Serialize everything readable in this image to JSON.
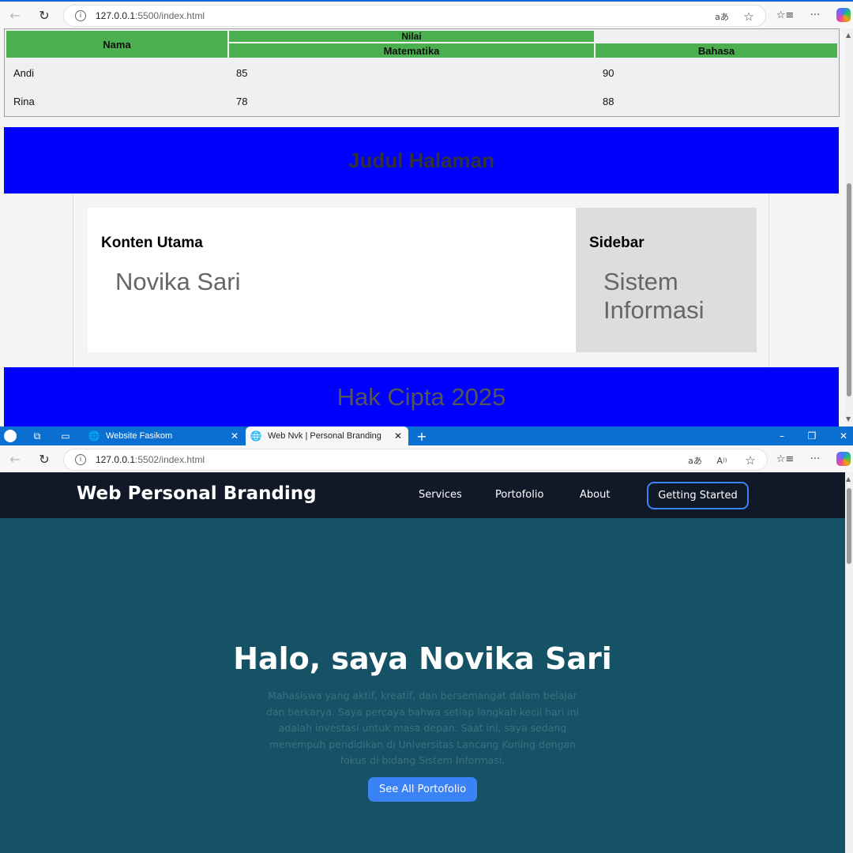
{
  "window_top": {
    "address_bar": {
      "host": "127.0.0.1",
      "path": ":5500/index.html"
    },
    "table": {
      "headers": {
        "nama": "Nama",
        "nilai": "Nilai",
        "matematika": "Matematika",
        "bahasa": "Bahasa"
      },
      "rows": [
        {
          "nama": "Andi",
          "matematika": "85",
          "bahasa": "90"
        },
        {
          "nama": "Rina",
          "matematika": "78",
          "bahasa": "88"
        }
      ]
    },
    "header_title": "Judul Halaman",
    "main": {
      "title": "Konten Utama",
      "text": "Novika Sari"
    },
    "sidebar": {
      "title": "Sidebar",
      "text": "Sistem Informasi"
    },
    "footer_text": "Hak Cipta 2025",
    "colors": {
      "table_header": "#4caf50",
      "header_bg": "#0000ff",
      "sidebar_bg": "#dddddd"
    }
  },
  "window_bottom": {
    "tabs": [
      {
        "label": "Website Fasikom",
        "active": false
      },
      {
        "label": "Web Nvk | Personal Branding",
        "active": true
      }
    ],
    "address_bar": {
      "host": "127.0.0.1",
      "path": ":5502/index.html"
    },
    "site": {
      "brand": "Web Personal Branding",
      "nav": [
        "Services",
        "Portofolio",
        "About"
      ],
      "cta_label": "Getting Started",
      "hero_title": "Halo, saya Novika Sari",
      "hero_text": "Mahasiswa yang aktif, kreatif, dan bersemangat dalam belajar dan berkarya. Saya percaya bahwa setiap langkah kecil hari ini adalah investasi untuk masa depan. Saat ini, saya sedang menempuh pendidikan di Universitas Lancang Kuning dengan fokus di bidang Sistem Informasi.",
      "hero_button": "See All Portofolio"
    },
    "colors": {
      "tabstrip": "#0b6fd1",
      "navbar": "#111827",
      "hero_bg": "#155266",
      "accent": "#3b82f6"
    }
  },
  "icons": {
    "back": "←",
    "refresh": "↻",
    "info": "i",
    "read_aloud": "aあ",
    "favorite": "☆",
    "favorites_list": "☆≡",
    "more": "···",
    "close": "✕",
    "new_tab": "+",
    "minimize": "–",
    "restore": "❐",
    "globe": "🌐"
  }
}
